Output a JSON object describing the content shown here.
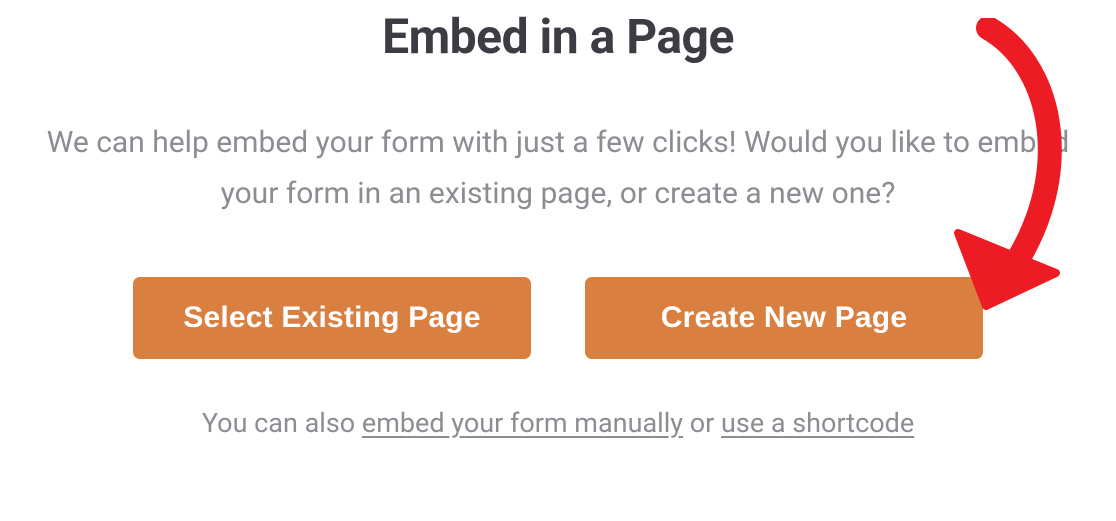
{
  "modal": {
    "title": "Embed in a Page",
    "description": "We can help embed your form with just a few clicks! Would you like to embed your form in an existing page, or create a new one?",
    "buttons": {
      "select_existing": "Select Existing Page",
      "create_new": "Create New Page"
    },
    "footer": {
      "prefix": "You can also ",
      "link_manual": "embed your form manually",
      "middle": " or ",
      "link_shortcode": "use a shortcode"
    }
  },
  "colors": {
    "accent": "#d97f40",
    "title_text": "#3b3d42",
    "body_text": "#8b8d92",
    "annotation": "#ed1c24"
  }
}
